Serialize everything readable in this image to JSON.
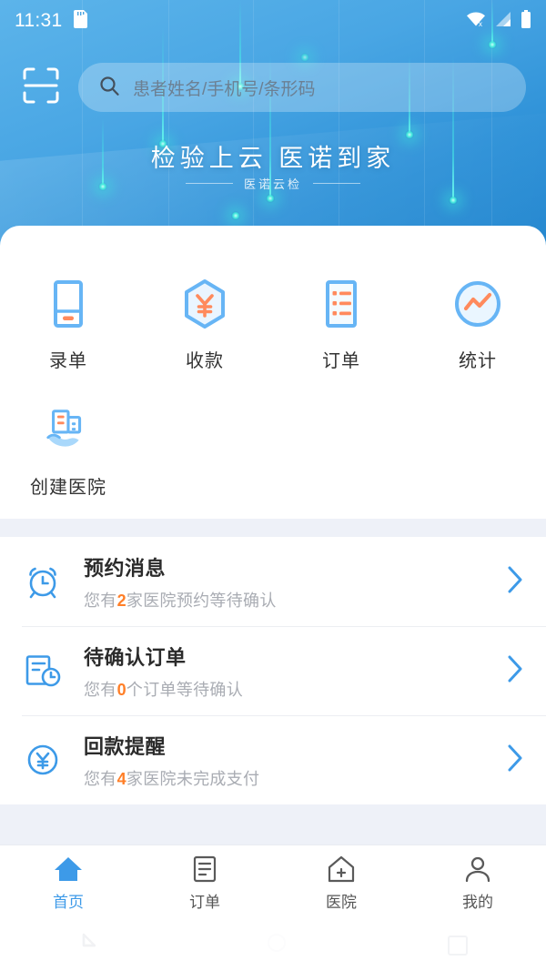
{
  "status_bar": {
    "time": "11:31",
    "icons": [
      "sdcard-icon",
      "wifi-off-icon",
      "signal-icon",
      "battery-icon"
    ]
  },
  "hero": {
    "scan_icon": "scan-frame-icon",
    "search": {
      "icon": "search-icon",
      "placeholder": "患者姓名/手机号/条形码",
      "value": ""
    },
    "title": "检验上云 医诺到家",
    "subtitle": "医诺云检"
  },
  "quick_actions": [
    {
      "label": "录单",
      "icon": "form-entry-icon"
    },
    {
      "label": "收款",
      "icon": "payment-hexagon-yuan-icon"
    },
    {
      "label": "订单",
      "icon": "order-list-icon"
    },
    {
      "label": "统计",
      "icon": "statistics-chart-icon"
    },
    {
      "label": "创建医院",
      "icon": "create-hospital-icon"
    }
  ],
  "notices": [
    {
      "title": "预约消息",
      "icon": "alarm-clock-icon",
      "sub_prefix": "您有",
      "count": "2",
      "sub_suffix": "家医院预约等待确认",
      "chevron": "chevron-right-icon"
    },
    {
      "title": "待确认订单",
      "icon": "document-clock-icon",
      "sub_prefix": "您有",
      "count": "0",
      "sub_suffix": "个订单等待确认",
      "chevron": "chevron-right-icon"
    },
    {
      "title": "回款提醒",
      "icon": "yuan-circle-icon",
      "sub_prefix": "您有",
      "count": "4",
      "sub_suffix": "家医院未完成支付",
      "chevron": "chevron-right-icon"
    }
  ],
  "tabbar": [
    {
      "label": "首页",
      "icon": "home-icon",
      "active": true
    },
    {
      "label": "订单",
      "icon": "document-icon",
      "active": false
    },
    {
      "label": "医院",
      "icon": "hospital-icon",
      "active": false
    },
    {
      "label": "我的",
      "icon": "person-icon",
      "active": false
    }
  ],
  "system_nav": {
    "back": "back-triangle-icon",
    "home": "home-circle-icon",
    "recents": "recents-square-icon"
  },
  "colors": {
    "brand_blue": "#3d9ae8",
    "hero_top": "#5cb4ea",
    "hero_bottom": "#2487cf",
    "accent_orange": "#ff7f28",
    "icon_blue": "#67b5f5",
    "band_gray": "#eef1f8"
  }
}
